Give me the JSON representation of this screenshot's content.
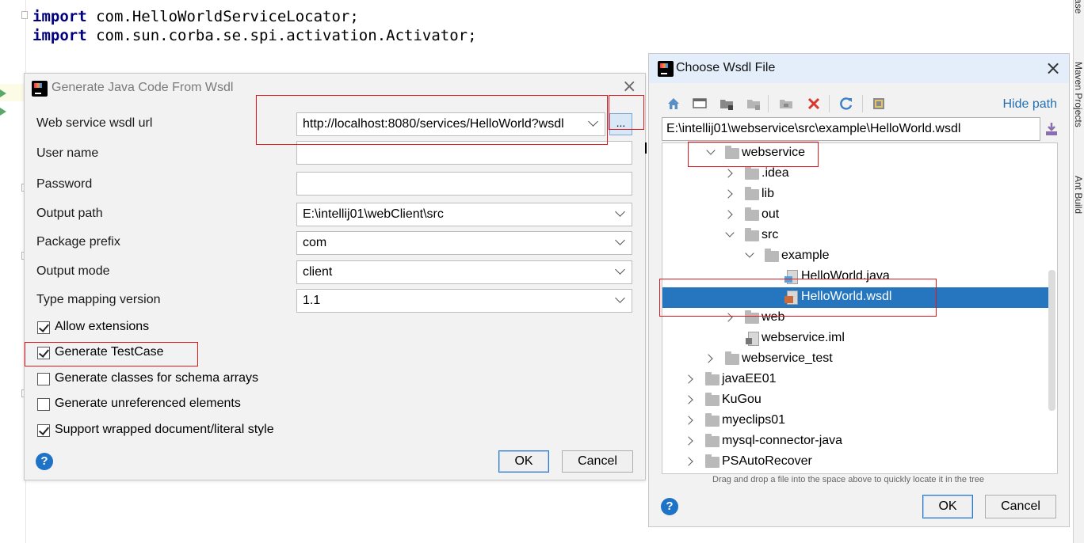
{
  "editor": {
    "lines": [
      {
        "keyword": "import",
        "text": " com.HelloWorldServiceLocator;"
      },
      {
        "keyword": "import",
        "text": " com.sun.corba.se.spi.activation.Activator;"
      }
    ],
    "right_strip": [
      "ase",
      "Maven Projects",
      "Ant Build"
    ]
  },
  "generate_dialog": {
    "title": "Generate Java Code From Wsdl",
    "close_glyph": "×",
    "fields": {
      "wsdl_url_label": "Web service wsdl url",
      "wsdl_url_value": "http://localhost:8080/services/HelloWorld?wsdl",
      "browse_label": "...",
      "user_name_label": "User name",
      "user_name_value": "",
      "password_label": "Password",
      "password_value": "",
      "output_path_label": "Output path",
      "output_path_value": "E:\\intellij01\\webClient\\src",
      "package_prefix_label": "Package prefix",
      "package_prefix_value": "com",
      "output_mode_label": "Output mode",
      "output_mode_value": "client",
      "type_mapping_label": "Type mapping version",
      "type_mapping_value": "1.1"
    },
    "checkboxes": [
      {
        "label": "Allow extensions",
        "checked": true
      },
      {
        "label": "Generate TestCase",
        "checked": true
      },
      {
        "label": "Generate classes for schema arrays",
        "checked": false
      },
      {
        "label": "Generate unreferenced elements",
        "checked": false
      },
      {
        "label": "Support wrapped document/literal style",
        "checked": true
      }
    ],
    "help_label": "?",
    "ok_label": "OK",
    "cancel_label": "Cancel"
  },
  "wsdl_chooser": {
    "title": "Choose Wsdl File",
    "close_glyph": "×",
    "hide_path_label": "Hide path",
    "path_value": "E:\\intellij01\\webservice\\src\\example\\HelloWorld.wsdl",
    "toolbar_icons": [
      "home-icon",
      "desktop-icon",
      "project-folder-icon",
      "module-folder-icon",
      "new-folder-icon",
      "delete-icon",
      "refresh-icon",
      "show-hidden-icon"
    ],
    "tree": [
      {
        "label": "webservice",
        "expanded": true,
        "kind": "folder"
      },
      {
        "label": ".idea",
        "expanded": false,
        "kind": "folder"
      },
      {
        "label": "lib",
        "expanded": false,
        "kind": "folder"
      },
      {
        "label": "out",
        "expanded": false,
        "kind": "folder"
      },
      {
        "label": "src",
        "expanded": true,
        "kind": "folder"
      },
      {
        "label": "example",
        "expanded": true,
        "kind": "folder"
      },
      {
        "label": "HelloWorld.java",
        "kind": "java"
      },
      {
        "label": "HelloWorld.wsdl",
        "kind": "wsdl",
        "selected": true
      },
      {
        "label": "web",
        "expanded": false,
        "kind": "folder"
      },
      {
        "label": "webservice.iml",
        "kind": "iml"
      },
      {
        "label": "webservice_test",
        "expanded": false,
        "kind": "folder"
      },
      {
        "label": "javaEE01",
        "expanded": false,
        "kind": "folder"
      },
      {
        "label": "KuGou",
        "expanded": false,
        "kind": "folder"
      },
      {
        "label": "myeclips01",
        "expanded": false,
        "kind": "folder"
      },
      {
        "label": "mysql-connector-java",
        "expanded": false,
        "kind": "folder"
      },
      {
        "label": "PSAutoRecover",
        "expanded": false,
        "kind": "folder"
      }
    ],
    "hint": "Drag and drop a file into the space above to quickly locate it in the tree",
    "help_label": "?",
    "ok_label": "OK",
    "cancel_label": "Cancel"
  },
  "colors": {
    "accent_blue": "#2675bf",
    "annotation_red": "#e0181e",
    "keyword_navy": "#000080"
  }
}
